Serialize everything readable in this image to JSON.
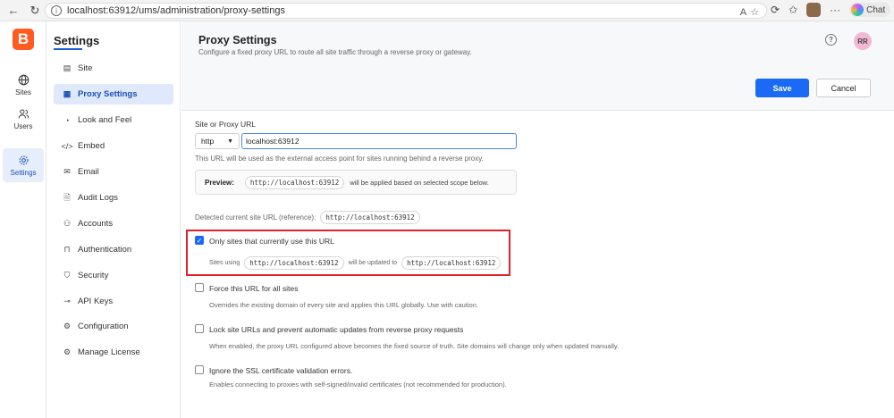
{
  "browser": {
    "url": "localhost:63912/ums/administration/proxy-settings",
    "chat_label": "Chat"
  },
  "rail": {
    "logo": "B",
    "items": [
      {
        "label": "Sites"
      },
      {
        "label": "Users"
      },
      {
        "label": "Settings"
      }
    ]
  },
  "sidebar": {
    "title": "Settings",
    "items": [
      {
        "label": "Site",
        "icon": "layout-icon"
      },
      {
        "label": "Proxy Settings",
        "icon": "proxy-icon"
      },
      {
        "label": "Look and Feel",
        "icon": "palette-icon"
      },
      {
        "label": "Embed",
        "icon": "code-icon"
      },
      {
        "label": "Email",
        "icon": "mail-icon"
      },
      {
        "label": "Audit Logs",
        "icon": "file-search-icon"
      },
      {
        "label": "Accounts",
        "icon": "users-icon"
      },
      {
        "label": "Authentication",
        "icon": "lock-icon"
      },
      {
        "label": "Security",
        "icon": "shield-icon"
      },
      {
        "label": "API Keys",
        "icon": "key-icon"
      },
      {
        "label": "Configuration",
        "icon": "gear-icon"
      },
      {
        "label": "Manage License",
        "icon": "gear-icon"
      }
    ]
  },
  "header": {
    "title": "Proxy Settings",
    "subtitle": "Configure a fixed proxy URL to route all site traffic through a reverse proxy or gateway.",
    "avatar": "RR",
    "save_label": "Save",
    "cancel_label": "Cancel"
  },
  "form": {
    "url_label": "Site or Proxy URL",
    "scheme": "http",
    "url_value": "localhost:63912",
    "url_help": "This URL will be used as the external access point for sites running behind a reverse proxy.",
    "preview_label": "Preview:",
    "preview_url": "http://localhost:63912",
    "preview_suffix": "will be applied based on selected scope below.",
    "detected_label": "Detected current site URL (reference):",
    "detected_url": "http://localhost:63912"
  },
  "options": [
    {
      "label": "Only sites that currently use this URL",
      "checked": true,
      "desc_prefix": "Sites using",
      "from_url": "http://localhost:63912",
      "desc_mid": "will be updated to",
      "to_url": "http://localhost:63912"
    },
    {
      "label": "Force this URL for all sites",
      "checked": false,
      "desc": "Overrides the existing domain of every site and applies this URL globally. Use with caution."
    },
    {
      "label": "Lock site URLs and prevent automatic updates from reverse proxy requests",
      "checked": false,
      "desc": "When enabled, the proxy URL configured above becomes the fixed source of truth. Site domains will change only when updated manually."
    },
    {
      "label": "Ignore the SSL certificate validation errors.",
      "checked": false,
      "desc": "Enables connecting to proxies with self-signed/invalid certificates (not recommended for production)."
    }
  ],
  "colors": {
    "accent": "#1a6af5",
    "logo": "#ff5a1f",
    "highlight_box": "#e0202a"
  }
}
